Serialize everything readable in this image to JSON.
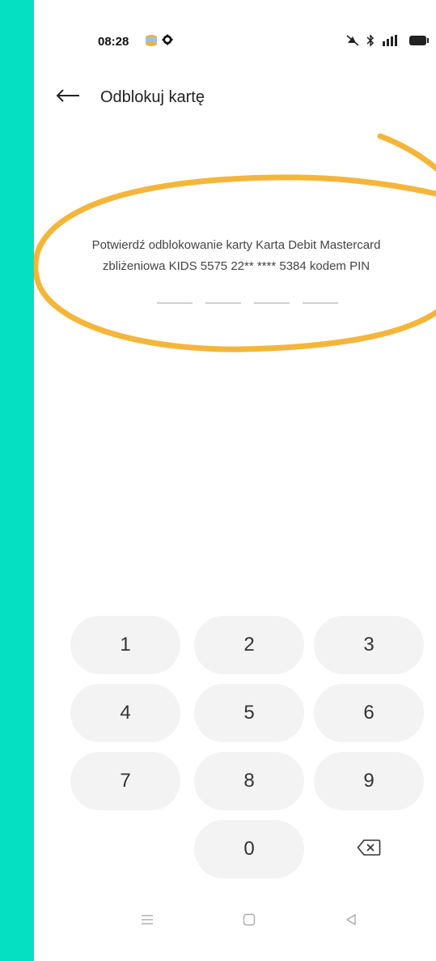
{
  "status_bar": {
    "time": "08:28",
    "icons": [
      "app-notification-icon",
      "gear-icon",
      "mute-icon",
      "bluetooth-icon",
      "signal-icon",
      "battery-icon"
    ]
  },
  "header": {
    "title": "Odblokuj kartę",
    "back_icon": "arrow-left-icon"
  },
  "content": {
    "message_line1": "Potwierdź odblokowanie karty Karta Debit Mastercard",
    "message_line2": "zbliżeniowa KIDS 5575 22** **** 5384 kodem PIN",
    "pin_length": 4
  },
  "keypad": {
    "keys": [
      "1",
      "2",
      "3",
      "4",
      "5",
      "6",
      "7",
      "8",
      "9",
      "0"
    ],
    "backspace_icon": "backspace-icon"
  },
  "nav_bar": {
    "icons": [
      "menu-icon",
      "home-icon",
      "back-triangle-icon"
    ]
  },
  "colors": {
    "background_frame": "#05e0c2",
    "annotation": "#f4b63a",
    "key_background": "#f3f3f3"
  }
}
